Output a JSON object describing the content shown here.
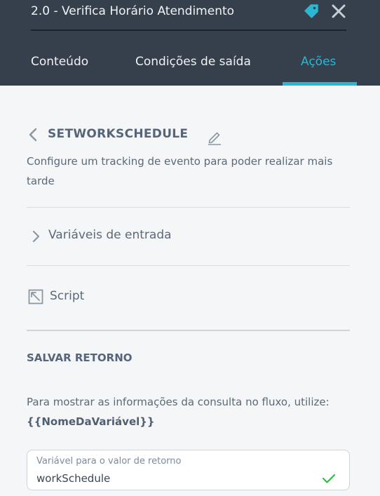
{
  "header": {
    "title": "2.0 - Verifica Horário Atendimento",
    "icons": {
      "tag": "tag-icon",
      "close": "close-icon"
    },
    "accent_color": "#29b7d3",
    "tabs": [
      {
        "label": "Conteúdo",
        "active": false
      },
      {
        "label": "Condições de saída",
        "active": false
      },
      {
        "label": "Ações",
        "active": true
      }
    ]
  },
  "action": {
    "name": "SETWORKSCHEDULE",
    "description": "Configure um tracking de evento para poder realizar mais tarde",
    "input_variables_label": "Variáveis de entrada",
    "script_label": "Script"
  },
  "save_return": {
    "title": "SALVAR RETORNO",
    "hint": "Para mostrar as informações da consulta no fluxo, utilize:",
    "hint_variable": "{{NomeDaVariável}}",
    "field": {
      "label": "Variável para o valor de retorno",
      "value": "workSchedule",
      "valid": true,
      "valid_color": "#3bb54a"
    }
  }
}
